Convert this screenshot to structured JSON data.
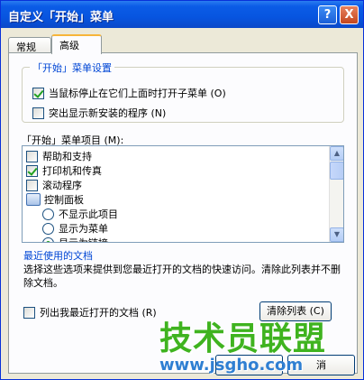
{
  "window": {
    "title": "自定义「开始」菜单",
    "help_label": "?",
    "close_label": "X"
  },
  "tabs": [
    {
      "label": "常规",
      "active": false
    },
    {
      "label": "高级",
      "active": true
    }
  ],
  "settings_group": {
    "label": "「开始」菜单设置",
    "options": [
      {
        "label": "当鼠标停止在它们上面时打开子菜单 (O)",
        "checked": true
      },
      {
        "label": "突出显示新安装的程序 (N)",
        "checked": false
      }
    ]
  },
  "items_list": {
    "label": "「开始」菜单项目 (M):",
    "items": [
      {
        "label": "帮助和支持",
        "type": "checkbox",
        "checked": false
      },
      {
        "label": "打印机和传真",
        "type": "checkbox",
        "checked": true
      },
      {
        "label": "滚动程序",
        "type": "checkbox",
        "checked": false
      },
      {
        "label": "控制面板",
        "type": "header",
        "icon": "control-panel-icon"
      },
      {
        "label": "不显示此项目",
        "type": "radio",
        "checked": false
      },
      {
        "label": "显示为菜单",
        "type": "radio",
        "checked": false
      },
      {
        "label": "显示为链接",
        "type": "radio",
        "checked": true
      }
    ]
  },
  "recent_docs": {
    "label": "最近使用的文档",
    "description": "选择这些选项来提供到您最近打开的文档的快速访问。清除此列表并不删除文档。",
    "list_checkbox_label": "列出我最近打开的文档 (R)",
    "list_checked": false,
    "clear_button": "清除列表 (C)"
  },
  "footer": {
    "cancel_label": "消"
  },
  "watermark": {
    "main": "技术员联盟",
    "url": "www.jsgho.com"
  },
  "colors": {
    "title_bar": "#0755e0",
    "group_label": "#0046d5",
    "check_mark": "#21a121",
    "watermark_main": "#3fb31f",
    "watermark_url": "#2f7fd2"
  }
}
